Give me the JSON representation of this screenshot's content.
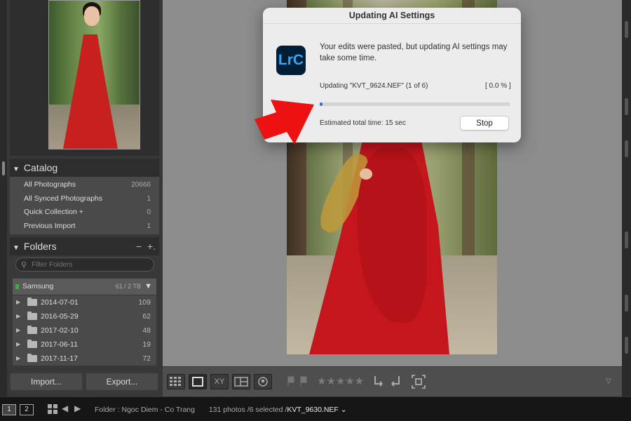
{
  "catalog": {
    "header": "Catalog",
    "items": [
      {
        "label": "All Photographs",
        "count": "20666"
      },
      {
        "label": "All Synced Photographs",
        "count": "1"
      },
      {
        "label": "Quick Collection +",
        "count": "0"
      },
      {
        "label": "Previous Import",
        "count": "1"
      }
    ]
  },
  "folders": {
    "header": "Folders",
    "header_actions": [
      "−",
      "+."
    ],
    "search_placeholder": "Filter Folders",
    "volume": {
      "name": "Samsung",
      "info": "61 / 2 TB"
    },
    "items": [
      {
        "name": "2014-07-01",
        "count": "109"
      },
      {
        "name": "2016-05-29",
        "count": "62"
      },
      {
        "name": "2017-02-10",
        "count": "48"
      },
      {
        "name": "2017-06-11",
        "count": "19"
      },
      {
        "name": "2017-11-17",
        "count": "72"
      }
    ]
  },
  "buttons": {
    "import": "Import...",
    "export": "Export..."
  },
  "dialog": {
    "title": "Updating AI Settings",
    "icon_text": "LrC",
    "message": "Your edits were pasted, but updating AI settings may take some time.",
    "status": "Updating \"KVT_9624.NEF\" (1 of 6)",
    "percent_text": "[ 0.0 % ]",
    "progress": 0.0,
    "estimate": "Estimated total time: 15 sec",
    "stop_label": "Stop",
    "accent_color": "#2f6fd6"
  },
  "toolbar": {
    "icons": [
      "grid-view-icon",
      "loupe-view-icon",
      "compare-view-icon",
      "survey-view-icon",
      "people-view-icon",
      "flag-icon",
      "reject-flag-icon",
      "rotate-left-icon",
      "rotate-right-icon",
      "crop-icon"
    ],
    "compare_label": "XY",
    "rating_stars": "★★★★★"
  },
  "filmstrip": {
    "monitor1": "1",
    "monitor2": "2",
    "folder_label": "Folder : Ngoc Diem - Co Trang",
    "photo_count": "131 photos /6 selected /",
    "current_file": "KVT_9630.NEF",
    "current_caret": "⌄"
  },
  "annotation": {
    "arrow_color": "#ee1111"
  }
}
